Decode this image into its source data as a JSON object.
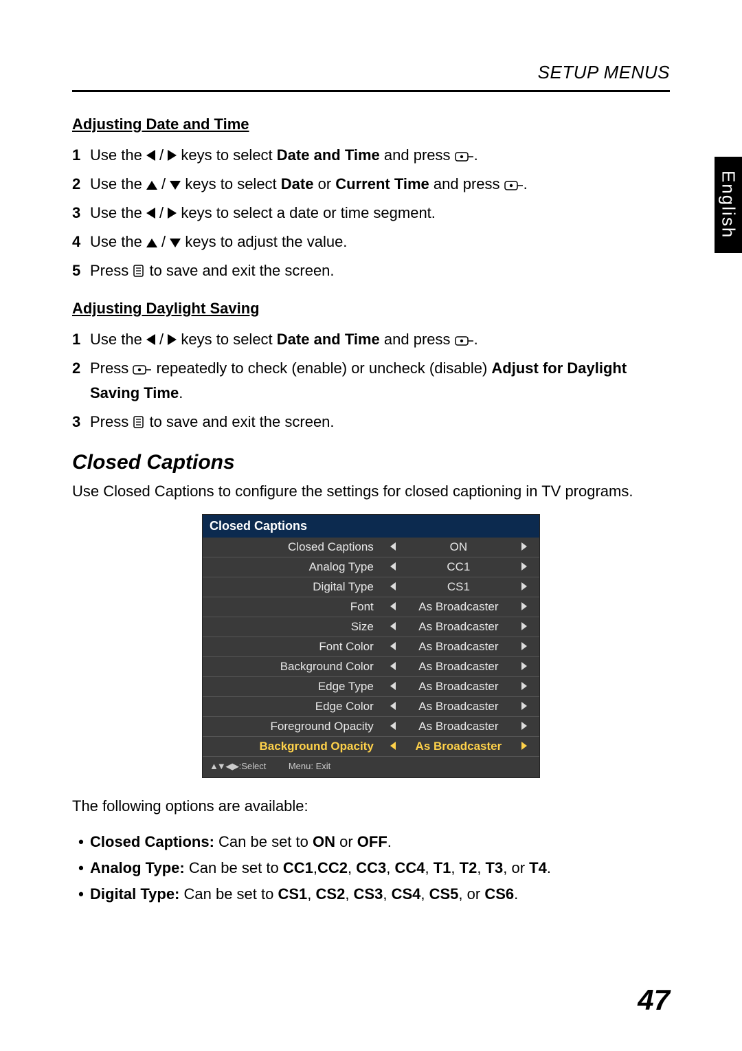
{
  "header": "SETUP MENUS",
  "lang_tab": "English",
  "page_number": "47",
  "sec1": {
    "title": "Adjusting Date and Time",
    "items": [
      {
        "pre": "Use the ",
        "mid": " keys to select ",
        "bold": "Date and Time",
        "post": " and press ",
        "post2": "."
      },
      {
        "pre": "Use the ",
        "mid": " keys to select ",
        "bold": "Date",
        "join": " or ",
        "bold2": "Current Time",
        "post": " and press ",
        "post2": "."
      },
      {
        "pre": "Use the ",
        "mid": " keys to select a date or time segment."
      },
      {
        "pre": "Use the ",
        "mid": " keys to adjust the value."
      },
      {
        "pre": "Press ",
        "post": " to save and exit the screen."
      }
    ]
  },
  "sec2": {
    "title": "Adjusting Daylight Saving",
    "items": [
      {
        "pre": "Use the ",
        "mid": " keys to select ",
        "bold": "Date and Time",
        "post": " and press ",
        "post2": "."
      },
      {
        "pre": "Press ",
        "mid": " repeatedly to check (enable) or uncheck (disable) ",
        "bold": "Adjust for Daylight Saving Time",
        "post": "."
      },
      {
        "pre": "Press ",
        "post": " to save and exit the screen."
      }
    ]
  },
  "cc": {
    "heading": "Closed Captions",
    "lead": "Use Closed Captions to configure the settings for closed captioning in TV programs.",
    "osd_title": "Closed Captions",
    "rows": [
      {
        "label": "Closed Captions",
        "value": "ON"
      },
      {
        "label": "Analog Type",
        "value": "CC1"
      },
      {
        "label": "Digital Type",
        "value": "CS1"
      },
      {
        "label": "Font",
        "value": "As Broadcaster"
      },
      {
        "label": "Size",
        "value": "As Broadcaster"
      },
      {
        "label": "Font Color",
        "value": "As Broadcaster"
      },
      {
        "label": "Background Color",
        "value": "As Broadcaster"
      },
      {
        "label": "Edge Type",
        "value": "As Broadcaster"
      },
      {
        "label": "Edge Color",
        "value": "As Broadcaster"
      },
      {
        "label": "Foreground Opacity",
        "value": "As Broadcaster"
      },
      {
        "label": "Background Opacity",
        "value": "As Broadcaster",
        "hl": true
      }
    ],
    "footer_select": ":Select",
    "footer_menu": "Menu: Exit",
    "after": "The following options are available:",
    "bullets": [
      {
        "b": "Closed Captions:",
        "t": " Can be set to ",
        "b2": "ON",
        "t2": " or ",
        "b3": "OFF",
        "t3": "."
      },
      {
        "b": "Analog Type:",
        "t": " Can be set to ",
        "b2": "CC1",
        "t2": ",",
        "b3": "CC2",
        "t3": ", ",
        "b4": "CC3",
        "t4": ", ",
        "b5": "CC4",
        "t5": ", ",
        "b6": "T1",
        "t6": ", ",
        "b7": "T2",
        "t7": ", ",
        "b8": "T3",
        "t8": ", or ",
        "b9": "T4",
        "t9": "."
      },
      {
        "b": "Digital Type:",
        "t": " Can be set to ",
        "b2": "CS1",
        "t2": ", ",
        "b3": "CS2",
        "t3": ", ",
        "b4": "CS3",
        "t4": ", ",
        "b5": "CS4",
        "t5": ", ",
        "b6": "CS5",
        "t6": ", or ",
        "b7": "CS6",
        "t7": "."
      }
    ]
  }
}
